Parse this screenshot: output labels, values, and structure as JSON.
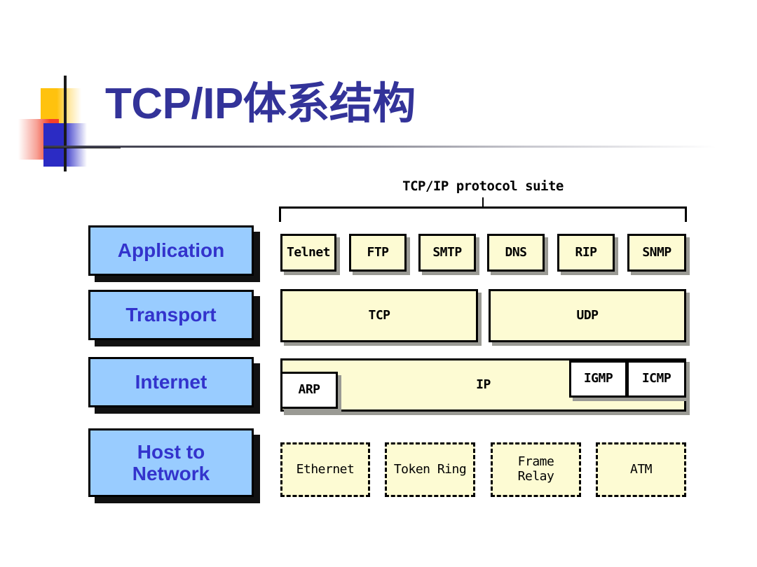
{
  "slide": {
    "title": "TCP/IP体系结构",
    "logo": {
      "square_yellow": "#FFC20E",
      "square_red": "#F4402A",
      "square_blue": "#2B2BC4",
      "crosshair_color": "#1a1a1a"
    },
    "title_color": "#333399"
  },
  "diagram": {
    "suite_label": "TCP/IP protocol suite",
    "layer_box_fill": "#99CCFF",
    "layer_text_color": "#3333CC",
    "protocol_box_fill": "#FDFBD3",
    "layers": [
      {
        "name": "Application",
        "label": "Application"
      },
      {
        "name": "Transport",
        "label": "Transport"
      },
      {
        "name": "Internet",
        "label": "Internet"
      },
      {
        "name": "HostToNetwork",
        "label": "Host to\nNetwork"
      }
    ],
    "application_protocols": [
      {
        "label": "Telnet"
      },
      {
        "label": "FTP"
      },
      {
        "label": "SMTP"
      },
      {
        "label": "DNS"
      },
      {
        "label": "RIP"
      },
      {
        "label": "SNMP"
      }
    ],
    "transport_protocols": [
      {
        "label": "TCP"
      },
      {
        "label": "UDP"
      }
    ],
    "internet_protocols": [
      {
        "label": "ARP"
      },
      {
        "label": "IP"
      },
      {
        "label": "IGMP"
      },
      {
        "label": "ICMP"
      }
    ],
    "host_to_network_protocols": [
      {
        "label": "Ethernet"
      },
      {
        "label": "Token Ring"
      },
      {
        "label": "Frame\nRelay"
      },
      {
        "label": "ATM"
      }
    ]
  }
}
